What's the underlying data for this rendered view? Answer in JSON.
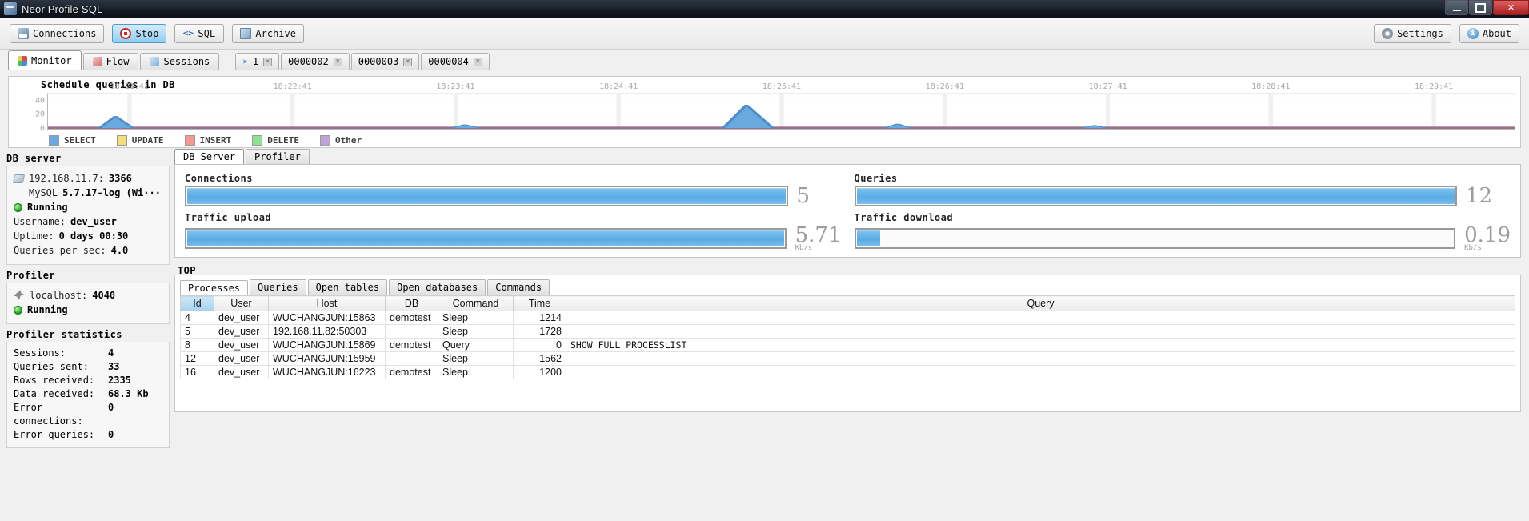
{
  "window": {
    "title": "Neor Profile SQL",
    "app_icon": "app-icon",
    "minimize": "–",
    "maximize": "□",
    "close": "✕"
  },
  "toolbar": {
    "buttons": [
      {
        "label": "Connections",
        "icon": "connections-icon",
        "active": false
      },
      {
        "label": "Stop",
        "icon": "stop-icon",
        "active": true
      },
      {
        "label": "SQL",
        "icon": "sql-icon",
        "active": false
      },
      {
        "label": "Archive",
        "icon": "archive-icon",
        "active": false
      }
    ],
    "right_buttons": [
      {
        "label": "Settings",
        "icon": "gear-icon"
      },
      {
        "label": "About",
        "icon": "info-icon"
      }
    ]
  },
  "main_tabs": [
    {
      "label": "Monitor",
      "icon": "monitor-icon",
      "selected": true
    },
    {
      "label": "Flow",
      "icon": "flow-icon",
      "selected": false
    },
    {
      "label": "Sessions",
      "icon": "sessions-icon",
      "selected": false
    }
  ],
  "query_tabs": [
    {
      "label": "1",
      "arrow": "➤",
      "close": "✕"
    },
    {
      "label": "0000002",
      "arrow": "",
      "close": "✕"
    },
    {
      "label": "0000003",
      "arrow": "",
      "close": "✕"
    },
    {
      "label": "0000004",
      "arrow": "",
      "close": "✕"
    }
  ],
  "chart_data": {
    "type": "area",
    "title": "Schedule queries in DB",
    "xlabel": "",
    "ylabel": "",
    "ylim": [
      0,
      50
    ],
    "yticks": [
      0,
      20,
      40
    ],
    "grid": true,
    "legend_position": "bottom",
    "x_tick_labels": [
      "18:21:41",
      "18:22:41",
      "18:23:41",
      "18:24:41",
      "18:25:41",
      "18:26:41",
      "18:27:41",
      "18:28:41",
      "18:29:41"
    ],
    "series": [
      {
        "name": "SELECT",
        "color": "#6aa9e0",
        "points": [
          {
            "x": 3.5,
            "y": 0
          },
          {
            "x": 4.6,
            "y": 17
          },
          {
            "x": 5.8,
            "y": 0
          },
          {
            "x": 27.5,
            "y": 0
          },
          {
            "x": 28.4,
            "y": 5
          },
          {
            "x": 29.4,
            "y": 0
          },
          {
            "x": 46.0,
            "y": 0
          },
          {
            "x": 47.6,
            "y": 33
          },
          {
            "x": 49.4,
            "y": 0
          },
          {
            "x": 57.0,
            "y": 0
          },
          {
            "x": 57.9,
            "y": 6
          },
          {
            "x": 58.8,
            "y": 0
          },
          {
            "x": 70.5,
            "y": 0
          },
          {
            "x": 71.3,
            "y": 4
          },
          {
            "x": 72.1,
            "y": 0
          }
        ]
      },
      {
        "name": "UPDATE",
        "color": "#f2d06b",
        "points": []
      },
      {
        "name": "INSERT",
        "color": "#f08a85",
        "points": []
      },
      {
        "name": "DELETE",
        "color": "#88dd8e",
        "points": []
      },
      {
        "name": "Other",
        "color": "#b49ccc",
        "points": []
      }
    ],
    "baseline_band": {
      "color": "#9b6f87",
      "height_units": 3
    },
    "legend": [
      {
        "label": "SELECT",
        "color": "#6aa9e0"
      },
      {
        "label": "UPDATE",
        "color": "#f7dd7a"
      },
      {
        "label": "INSERT",
        "color": "#f49891"
      },
      {
        "label": "DELETE",
        "color": "#90e096"
      },
      {
        "label": "Other",
        "color": "#bda4d4"
      }
    ]
  },
  "sidebar": {
    "db_server": {
      "title": "DB server",
      "address_label": "192.168.11.7:",
      "address_port": "3366",
      "version_prefix": "MySQL",
      "version": "5.7.17-log (Wi···",
      "status": "Running",
      "fields": [
        {
          "key": "Username:",
          "value": "dev_user"
        },
        {
          "key": "Uptime:",
          "value": "0 days 00:30"
        },
        {
          "key": "Queries per sec:",
          "value": "4.0"
        }
      ]
    },
    "profiler": {
      "title": "Profiler",
      "host_label": "localhost:",
      "host_port": "4040",
      "status": "Running"
    },
    "profiler_statistics": {
      "title": "Profiler statistics",
      "rows": [
        {
          "key": "Sessions:",
          "value": "4"
        },
        {
          "key": "Queries sent:",
          "value": "33"
        },
        {
          "key": "Rows received:",
          "value": "2335"
        },
        {
          "key": "Data received:",
          "value": "68.3 Kb"
        },
        {
          "key": "Error connections:",
          "value": "0"
        },
        {
          "key": "Error queries:",
          "value": "0"
        }
      ]
    }
  },
  "content_tabs": [
    {
      "label": "DB Server",
      "selected": true
    },
    {
      "label": "Profiler",
      "selected": false
    }
  ],
  "gauges": [
    {
      "name": "Connections",
      "label": "Connections",
      "value": "5",
      "unit": "",
      "percent": 100
    },
    {
      "name": "Queries",
      "label": "Queries",
      "value": "12",
      "unit": "",
      "percent": 100
    },
    {
      "name": "Traffic upload",
      "label": "Traffic upload",
      "value": "5.71",
      "unit": "Kb/s",
      "percent": 100
    },
    {
      "name": "Traffic download",
      "label": "Traffic download",
      "value": "0.19",
      "unit": "Kb/s",
      "percent": 4
    }
  ],
  "top": {
    "label": "TOP",
    "tabs": [
      {
        "label": "Processes",
        "selected": true
      },
      {
        "label": "Queries",
        "selected": false
      },
      {
        "label": "Open tables",
        "selected": false
      },
      {
        "label": "Open databases",
        "selected": false
      },
      {
        "label": "Commands",
        "selected": false
      }
    ],
    "columns": [
      "Id",
      "User",
      "Host",
      "DB",
      "Command",
      "Time",
      "Query"
    ],
    "sorted_column": "Id",
    "rows": [
      {
        "Id": "4",
        "User": "dev_user",
        "Host": "WUCHANGJUN:15863",
        "DB": "demotest",
        "Command": "Sleep",
        "Time": "1214",
        "Query": ""
      },
      {
        "Id": "5",
        "User": "dev_user",
        "Host": "192.168.11.82:50303",
        "DB": "",
        "Command": "Sleep",
        "Time": "1728",
        "Query": ""
      },
      {
        "Id": "8",
        "User": "dev_user",
        "Host": "WUCHANGJUN:15869",
        "DB": "demotest",
        "Command": "Query",
        "Time": "0",
        "Query": "SHOW FULL PROCESSLIST"
      },
      {
        "Id": "12",
        "User": "dev_user",
        "Host": "WUCHANGJUN:15959",
        "DB": "",
        "Command": "Sleep",
        "Time": "1562",
        "Query": ""
      },
      {
        "Id": "16",
        "User": "dev_user",
        "Host": "WUCHANGJUN:16223",
        "DB": "demotest",
        "Command": "Sleep",
        "Time": "1200",
        "Query": ""
      }
    ]
  }
}
